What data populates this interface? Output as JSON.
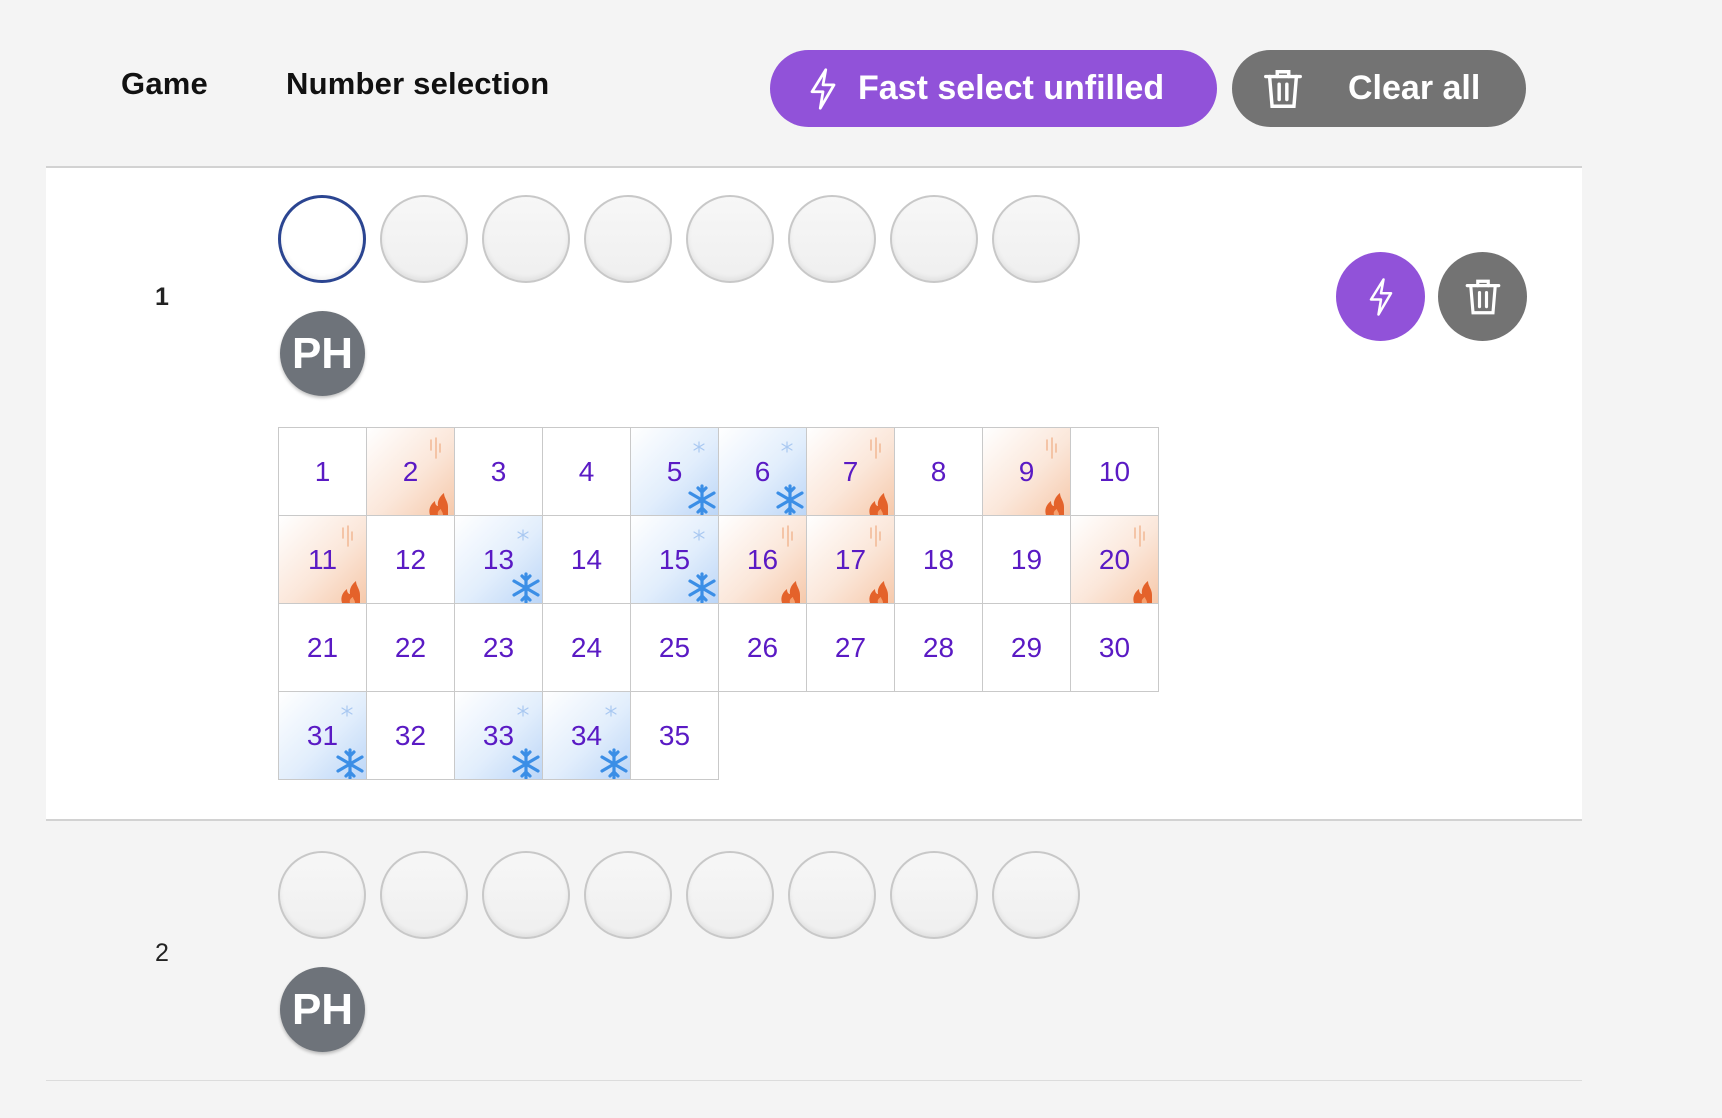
{
  "header": {
    "game_label": "Game",
    "selection_label": "Number selection",
    "fast_select_label": "Fast select unfilled",
    "clear_all_label": "Clear all"
  },
  "games": [
    {
      "number": "1",
      "avatar": "PH"
    },
    {
      "number": "2",
      "avatar": "PH"
    }
  ],
  "colors": {
    "accent": "#9152d9",
    "neutral": "#737373",
    "hot": "#e4622a",
    "cold": "#3b8ee6",
    "number_text": "#5a1ac4",
    "active_ring": "#2b4591"
  },
  "icons": {
    "fast": "lightning-icon",
    "clear": "trash-icon",
    "hot": "flame-icon",
    "cold": "snowflake-icon"
  },
  "number_grid": {
    "numbers": [
      "1",
      "2",
      "3",
      "4",
      "5",
      "6",
      "7",
      "8",
      "9",
      "10",
      "11",
      "12",
      "13",
      "14",
      "15",
      "16",
      "17",
      "18",
      "19",
      "20",
      "21",
      "22",
      "23",
      "24",
      "25",
      "26",
      "27",
      "28",
      "29",
      "30",
      "31",
      "32",
      "33",
      "34",
      "35"
    ],
    "hot": [
      "2",
      "7",
      "9",
      "11",
      "16",
      "17",
      "20"
    ],
    "cold": [
      "5",
      "6",
      "13",
      "15",
      "31",
      "33",
      "34"
    ]
  }
}
